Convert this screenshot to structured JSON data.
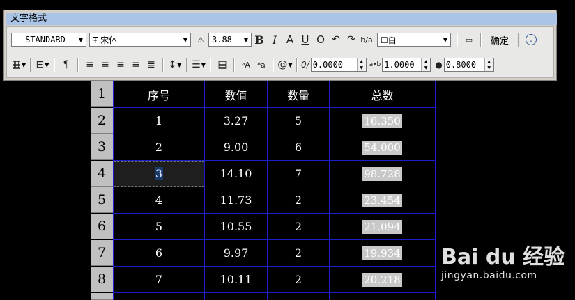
{
  "window": {
    "title": "文字格式"
  },
  "toolbar": {
    "style": "STANDARD",
    "font_icon": "Ŧ",
    "font": "宋体",
    "height": "3.88",
    "bold": "B",
    "italic": "I",
    "strike": "A",
    "underline": "U",
    "overline": "O",
    "undo": "↶",
    "redo": "↷",
    "stack": "b/a",
    "color": "☐白",
    "ruler": "▭",
    "ok": "确定",
    "options": "⌄",
    "oblique_label": "0/",
    "oblique": "0.0000",
    "tracking_label": "a•b",
    "tracking": "1.0000",
    "width_label": "●",
    "width": "0.8000"
  },
  "table": {
    "headers": [
      "序号",
      "数值",
      "数量",
      "总数"
    ],
    "row_numbers": [
      "1",
      "2",
      "3",
      "4",
      "5",
      "6",
      "7",
      "8"
    ],
    "rows": [
      [
        "1",
        "3.27",
        "5",
        "16.350"
      ],
      [
        "2",
        "9.00",
        "6",
        "54.000"
      ],
      [
        "3",
        "14.10",
        "7",
        "98.728"
      ],
      [
        "4",
        "11.73",
        "2",
        "23.454"
      ],
      [
        "5",
        "10.55",
        "2",
        "21.094"
      ],
      [
        "6",
        "9.97",
        "2",
        "19.934"
      ],
      [
        "7",
        "10.11",
        "2",
        "20.218"
      ]
    ]
  },
  "watermark": {
    "logo": "Bai du 经验",
    "url": "jingyan.baidu.com"
  }
}
